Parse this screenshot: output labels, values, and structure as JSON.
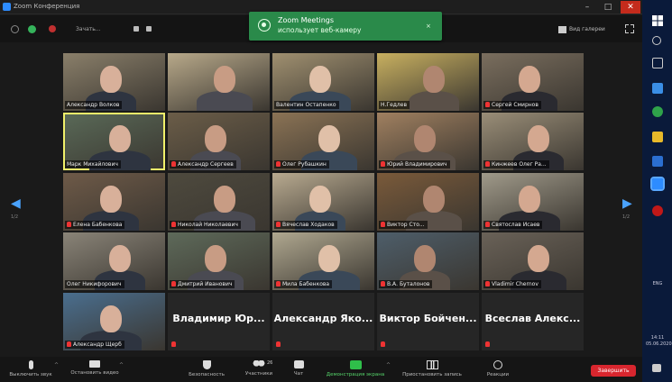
{
  "window": {
    "title": "Zoom Конференция",
    "controls": [
      "–",
      "□",
      "✕"
    ]
  },
  "topbar": {
    "view_label": "Зачать...",
    "gallery_label": "Вид галереи",
    "fullscreen_icon": "fullscreen-icon"
  },
  "notification": {
    "title": "Zoom Meetings",
    "message": "использует веб-камеру",
    "close": "×"
  },
  "participants": [
    {
      "name": "Александр Волков",
      "muted": false,
      "active": false
    },
    {
      "name": "",
      "muted": false,
      "active": false
    },
    {
      "name": "Валентин Остапенко",
      "muted": false,
      "active": false
    },
    {
      "name": "Н.Гедлев",
      "muted": false,
      "active": false
    },
    {
      "name": "Сергей Смирнов",
      "muted": true,
      "active": false
    },
    {
      "name": "Марк Михайлович",
      "muted": false,
      "active": true
    },
    {
      "name": "Александр Сергеев",
      "muted": true,
      "active": false
    },
    {
      "name": "Олег Рубашкин",
      "muted": true,
      "active": false
    },
    {
      "name": "Юрий Владимирович",
      "muted": true,
      "active": false
    },
    {
      "name": "Кинжеев Олег Ра...",
      "muted": true,
      "active": false
    },
    {
      "name": "Елена Бабенкова",
      "muted": true,
      "active": false
    },
    {
      "name": "Николай Николаевич",
      "muted": true,
      "active": false
    },
    {
      "name": "Вячеслав Ходаков",
      "muted": true,
      "active": false
    },
    {
      "name": "Виктор Сто...",
      "muted": true,
      "active": false
    },
    {
      "name": "Святослав Исаев",
      "muted": true,
      "active": false
    },
    {
      "name": "Олег Никифорович",
      "muted": false,
      "active": false
    },
    {
      "name": "Дмитрий Иванович",
      "muted": true,
      "active": false
    },
    {
      "name": "Мила Бабенкова",
      "muted": true,
      "active": false
    },
    {
      "name": "В.А. Буталонов",
      "muted": true,
      "active": false
    },
    {
      "name": "Vladimir Chernov",
      "muted": true,
      "active": false
    },
    {
      "name": "Александр Щерб",
      "muted": true,
      "active": false
    },
    {
      "name": "Владимир Юр...",
      "muted": true,
      "active": false,
      "text_only": true
    },
    {
      "name": "Александр Яко...",
      "muted": true,
      "active": false,
      "text_only": true
    },
    {
      "name": "Виктор Бойчен...",
      "muted": true,
      "active": false,
      "text_only": true
    },
    {
      "name": "Всеслав Алекс...",
      "muted": true,
      "active": false,
      "text_only": true
    }
  ],
  "pager": {
    "prev_label": "1/2",
    "next_label": "1/2"
  },
  "toolbar": {
    "mute": "Выключить звук",
    "video": "Остановить видео",
    "security": "Безопасность",
    "participants": "Участники",
    "participants_count": "26",
    "chat": "Чат",
    "share": "Демонстрация экрана",
    "record": "Приостановить запись",
    "reactions": "Реакции",
    "end": "Завершить"
  },
  "taskbar": {
    "time": "14:11",
    "date": "05.06.2020",
    "lang": "ENG"
  }
}
